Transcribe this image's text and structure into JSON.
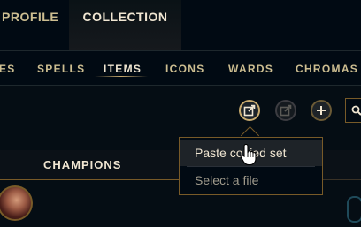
{
  "top_tabs": [
    {
      "label": "PROFILE",
      "active": false
    },
    {
      "label": "COLLECTION",
      "active": true
    }
  ],
  "sub_tabs": [
    {
      "label": "ES",
      "active": false
    },
    {
      "label": "SPELLS",
      "active": false
    },
    {
      "label": "ITEMS",
      "active": true
    },
    {
      "label": "ICONS",
      "active": false
    },
    {
      "label": "WARDS",
      "active": false
    },
    {
      "label": "CHROMAS",
      "active": false
    }
  ],
  "toolbar": {
    "edit_icon": "edit-set-icon",
    "export_icon": "export-icon",
    "add_icon": "plus-icon",
    "search_icon": "search-icon"
  },
  "dropdown": {
    "items": [
      {
        "label": "Paste copied set",
        "hovered": true
      },
      {
        "label": "Select a file",
        "hovered": false
      }
    ]
  },
  "section": {
    "champions_label": "CHAMPIONS"
  },
  "colors": {
    "gold": "#c8aa6e",
    "gold_light": "#f0e6d2",
    "background": "#010a13"
  }
}
